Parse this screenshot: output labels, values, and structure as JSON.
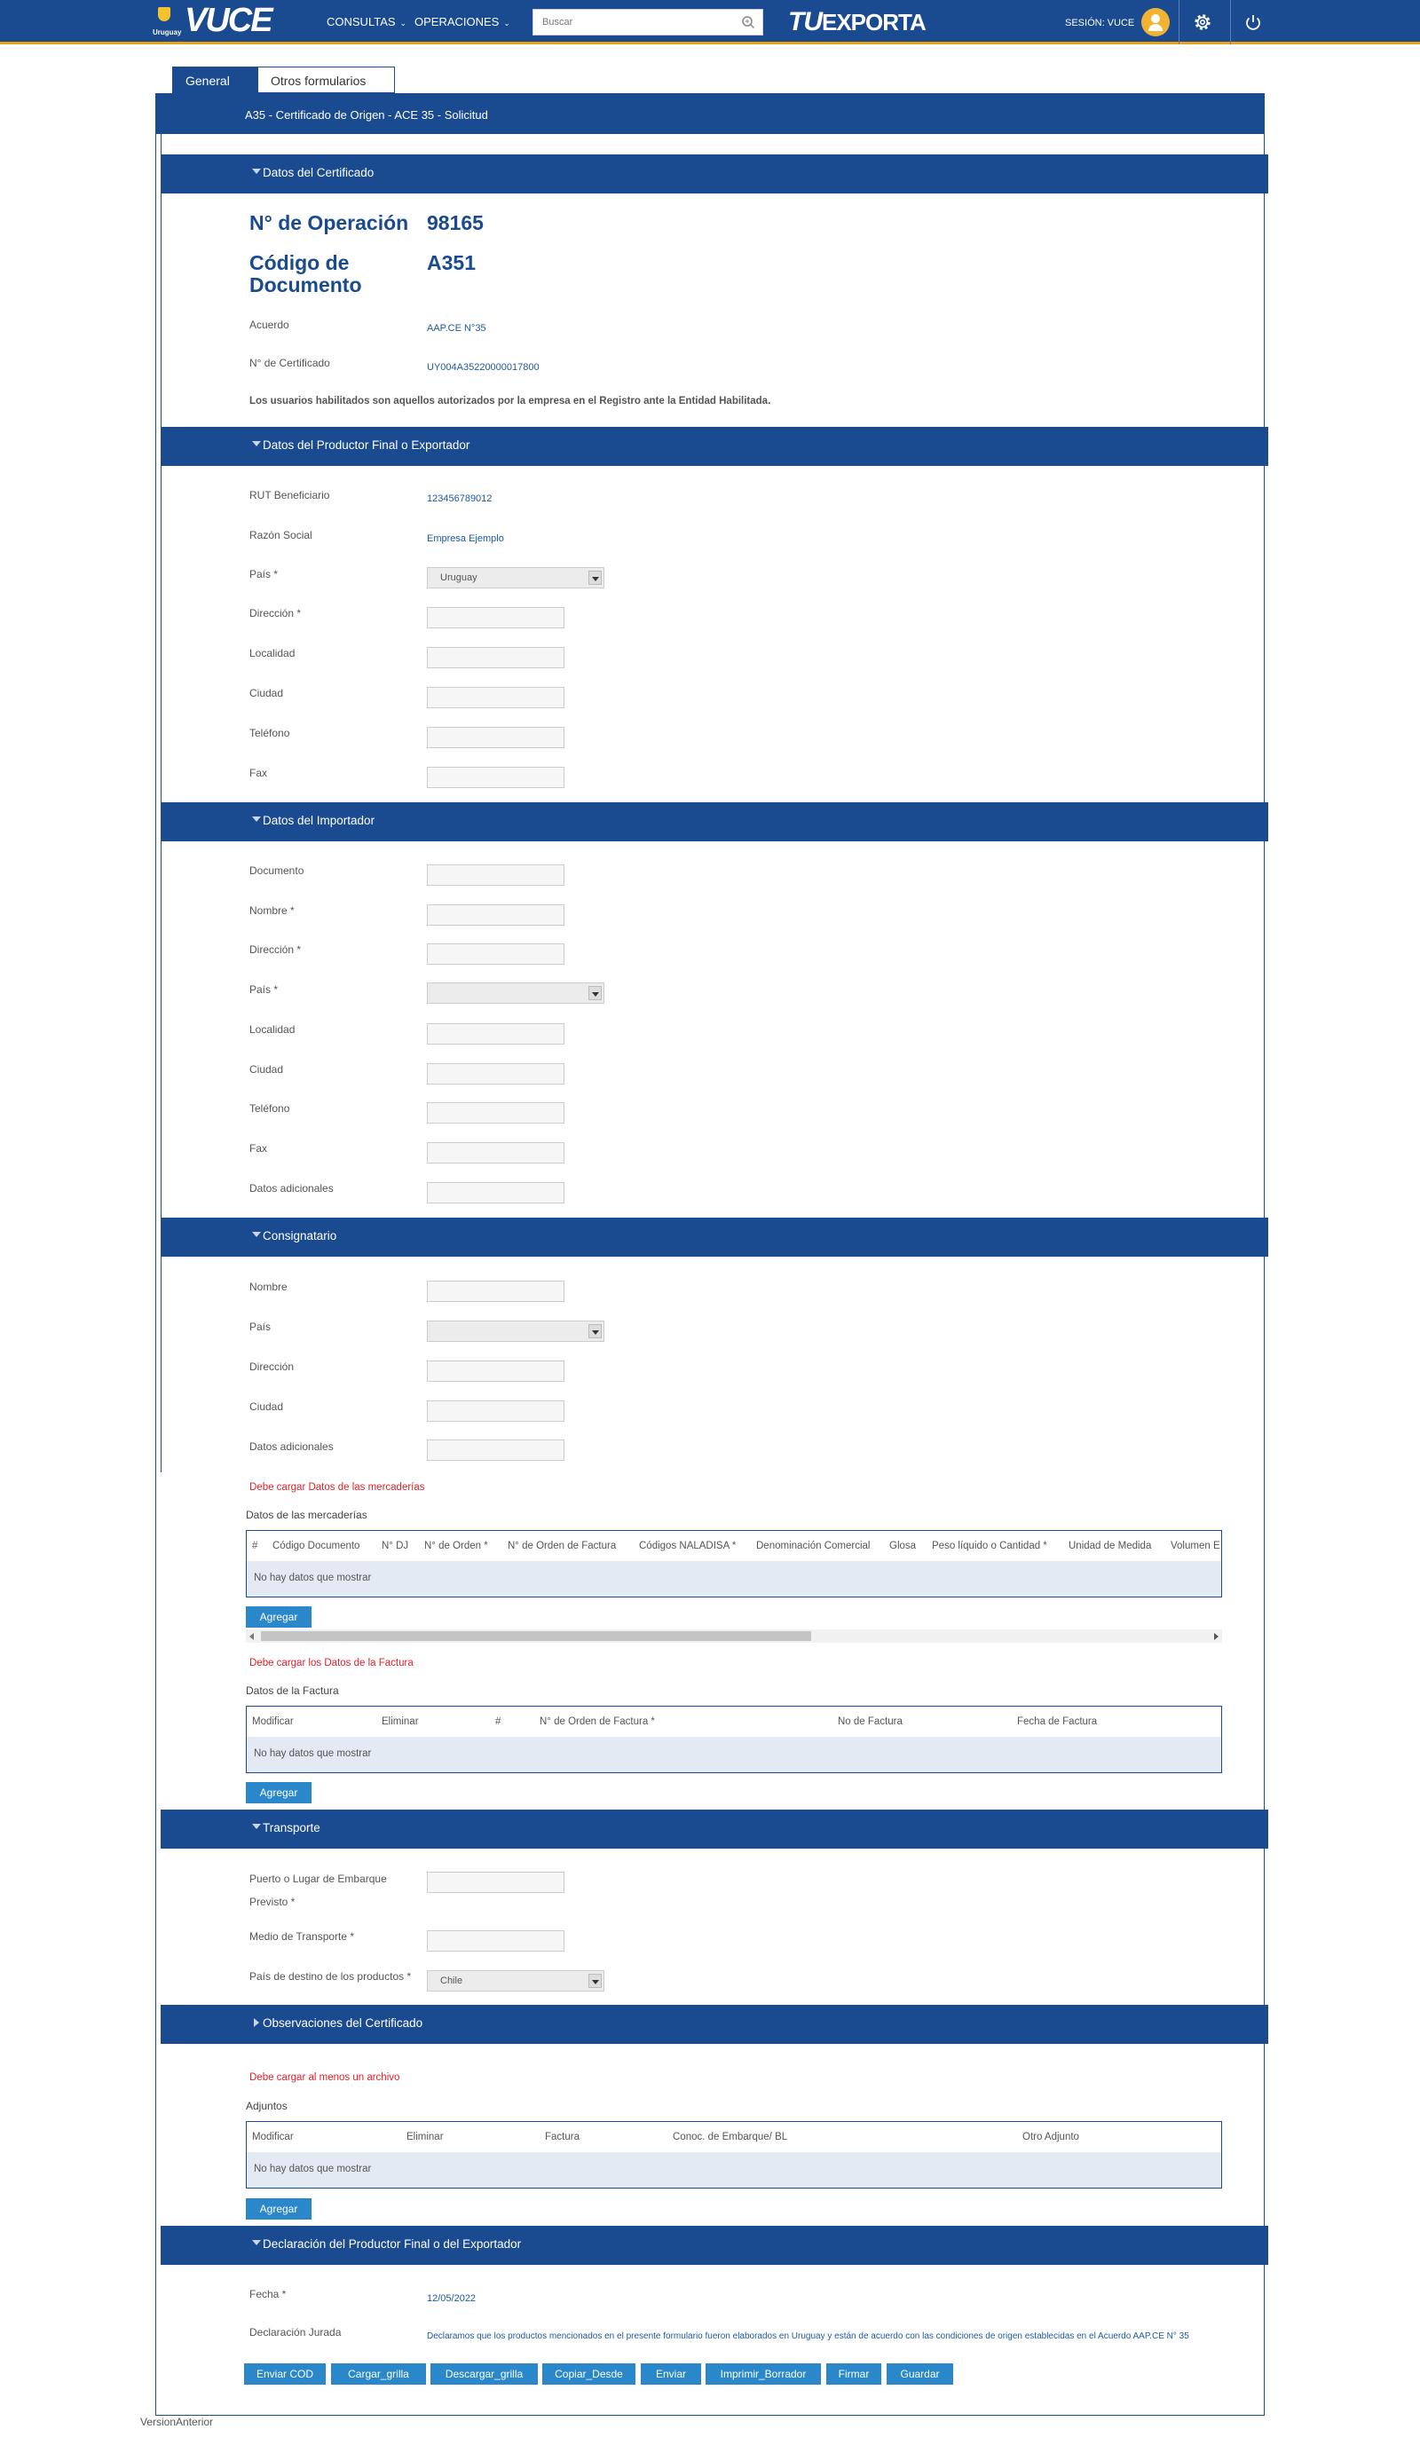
{
  "topbar": {
    "logo_country": "Uruguay",
    "logo_text": "VUCE",
    "nav": [
      {
        "label": "CONSULTAS"
      },
      {
        "label": "OPERACIONES"
      }
    ],
    "search_placeholder": "Buscar",
    "exporta_prefix": "TU",
    "exporta_text": "EXPORTA",
    "session": "SESIÓN: VUCE",
    "icons": [
      "search-icon",
      "avatar",
      "gear-icon",
      "power-icon"
    ],
    "accent_color": "#e8a317",
    "bar_color": "#1a4a8f"
  },
  "tabs": [
    {
      "label": "General",
      "active": true
    },
    {
      "label": "Otros formularios",
      "active": false
    }
  ],
  "form_title": "A35 - Certificado de Origen - ACE 35 - Solicitud",
  "certificado": {
    "section": "Datos del Certificado",
    "op_label": "N° de Operación",
    "op_value": "98165",
    "doc_label_1": "Código de",
    "doc_label_2": "Documento",
    "doc_value": "A351",
    "acuerdo_label": "Acuerdo",
    "acuerdo_value": "AAP.CE N°35",
    "cert_label": "N° de Certificado",
    "cert_value": "UY004A35220000017800",
    "note": "Los usuarios habilitados son aquellos autorizados por la empresa en el Registro ante la Entidad Habilitada."
  },
  "productor": {
    "section": "Datos del Productor Final o Exportador",
    "rut_label": "RUT Beneficiario",
    "rut_value": "123456789012",
    "razon_label": "Razón Social",
    "razon_value": "Empresa Ejemplo",
    "pais_label": "País *",
    "pais_value": "Uruguay",
    "direccion_label": "Dirección *",
    "localidad_label": "Localidad",
    "ciudad_label": "Ciudad",
    "telefono_label": "Teléfono",
    "fax_label": "Fax"
  },
  "importador": {
    "section": "Datos del Importador",
    "documento_label": "Documento",
    "nombre_label": "Nombre *",
    "direccion_label": "Dirección *",
    "pais_label": "País *",
    "localidad_label": "Localidad",
    "ciudad_label": "Ciudad",
    "telefono_label": "Teléfono",
    "fax_label": "Fax",
    "adicionales_label": "Datos adicionales"
  },
  "consignatario": {
    "section": "Consignatario",
    "nombre_label": "Nombre",
    "pais_label": "País",
    "direccion_label": "Dirección",
    "ciudad_label": "Ciudad",
    "adicionales_label": "Datos adicionales"
  },
  "mercaderias": {
    "error": "Debe cargar Datos de las mercaderías",
    "title": "Datos de las mercaderías",
    "columns": [
      "#",
      "Código Documento",
      "N° DJ",
      "N° de Orden *",
      "N° de Orden de Factura",
      "Códigos NALADISA *",
      "Denominación Comercial",
      "Glosa",
      "Peso líquido o Cantidad *",
      "Unidad de Medida",
      "Volumen E"
    ],
    "empty": "No hay datos que mostrar",
    "add": "Agregar"
  },
  "factura": {
    "error": "Debe cargar los Datos de la Factura",
    "title": "Datos de la Factura",
    "columns": [
      "Modificar",
      "Eliminar",
      "#",
      "N° de Orden de Factura *",
      "No de Factura",
      "Fecha de Factura"
    ],
    "empty": "No hay datos que mostrar",
    "add": "Agregar"
  },
  "transporte": {
    "section": "Transporte",
    "puerto_label_1": "Puerto o Lugar de Embarque",
    "puerto_label_2": "Previsto *",
    "medio_label": "Medio de Transporte *",
    "destino_label": "País de destino de los productos *",
    "destino_value": "Chile"
  },
  "observaciones": {
    "section": "Observaciones del Certificado"
  },
  "adjuntos": {
    "error": "Debe cargar al menos un archivo",
    "title": "Adjuntos",
    "columns": [
      "Modificar",
      "Eliminar",
      "Factura",
      "Conoc. de Embarque/ BL",
      "Otro Adjunto"
    ],
    "empty": "No hay datos que mostrar",
    "add": "Agregar"
  },
  "declaracion": {
    "section": "Declaración del Productor Final o del Exportador",
    "fecha_label": "Fecha *",
    "fecha_value": "12/05/2022",
    "jurada_label": "Declaración Jurada",
    "jurada_value": "Declaramos que los productos mencionados en el presente formulario fueron elaborados en Uruguay y están de acuerdo con las condiciones de origen establecidas en el Acuerdo AAP.CE N° 35"
  },
  "actions": [
    "Enviar COD",
    "Cargar_grilla",
    "Descargar_grilla",
    "Copiar_Desde",
    "Enviar",
    "Imprimir_Borrador",
    "Firmar",
    "Guardar"
  ],
  "footer_link": "VersionAnterior"
}
